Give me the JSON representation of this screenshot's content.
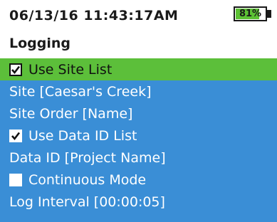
{
  "header": {
    "datetime": "06/13/16 11:43:17AM",
    "battery_label": "81%",
    "battery_level": 0.81
  },
  "title": "Logging",
  "colors": {
    "menu_background": "#3a8ed6",
    "selected_background": "#5cbf3a",
    "battery_fill": "#5cc134"
  },
  "menu": {
    "items": [
      {
        "label": "Use Site List",
        "checkbox": true,
        "checked": true,
        "selected": true
      },
      {
        "label": "Site [Caesar's Creek]"
      },
      {
        "label": "Site Order [Name]"
      },
      {
        "label": "Use Data ID List",
        "checkbox": true,
        "checked": true
      },
      {
        "label": "Data ID [Project Name]"
      },
      {
        "label": "Continuous Mode",
        "checkbox": true,
        "checked": false
      },
      {
        "label": "Log Interval [00:00:05]"
      }
    ]
  }
}
